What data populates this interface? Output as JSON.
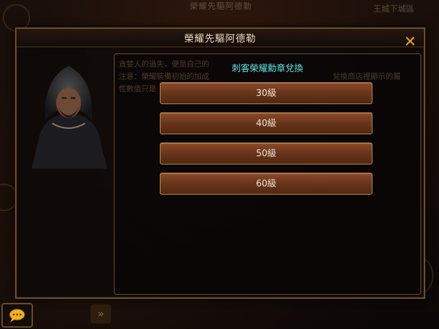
{
  "background": {
    "top_title": "榮耀先驅阿德勒",
    "top_right": "王城下城區"
  },
  "dialog": {
    "title": "榮耀先驅阿德勒",
    "close_label": "✕",
    "npc_text_line1": "貪婪人的過失，便是自己的",
    "npc_text_line2": "注意：榮耀裝備初始的加成",
    "npc_text_line3": "性數值只是",
    "npc_text_line2_tail": "兌換商店裡顯示的屬",
    "exchange_title": "刺客榮耀勳章兌換",
    "options": [
      "30級",
      "40級",
      "50級",
      "60級"
    ]
  },
  "colors": {
    "accent_close": "#f0a020",
    "exchange_title": "#5fe0e0",
    "button_fill": "#6a361d",
    "border": "#6a5030"
  }
}
